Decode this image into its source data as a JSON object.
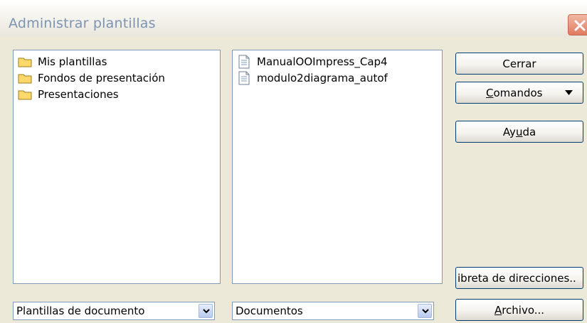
{
  "window": {
    "title": "Administrar plantillas"
  },
  "left_panel": {
    "items": [
      {
        "label": "Mis plantillas"
      },
      {
        "label": "Fondos de presentación"
      },
      {
        "label": "Presentaciones"
      }
    ],
    "select_value": "Plantillas de documento"
  },
  "middle_panel": {
    "items": [
      {
        "label": "ManualOOImpress_Cap4"
      },
      {
        "label": "modulo2diagrama_autof"
      }
    ],
    "select_value": "Documentos"
  },
  "buttons": {
    "close_label": "Cerrar",
    "commands_accel": "C",
    "commands_rest": "omandos",
    "help_pre": "Ay",
    "help_accel": "u",
    "help_post": "da",
    "address_book_label": "ibreta de direcciones..",
    "file_accel": "A",
    "file_rest": "rchivo..."
  },
  "colors": {
    "folder": "#ffd86b",
    "title_text": "#7c93b4",
    "dialog_bg": "#ece9d8"
  }
}
